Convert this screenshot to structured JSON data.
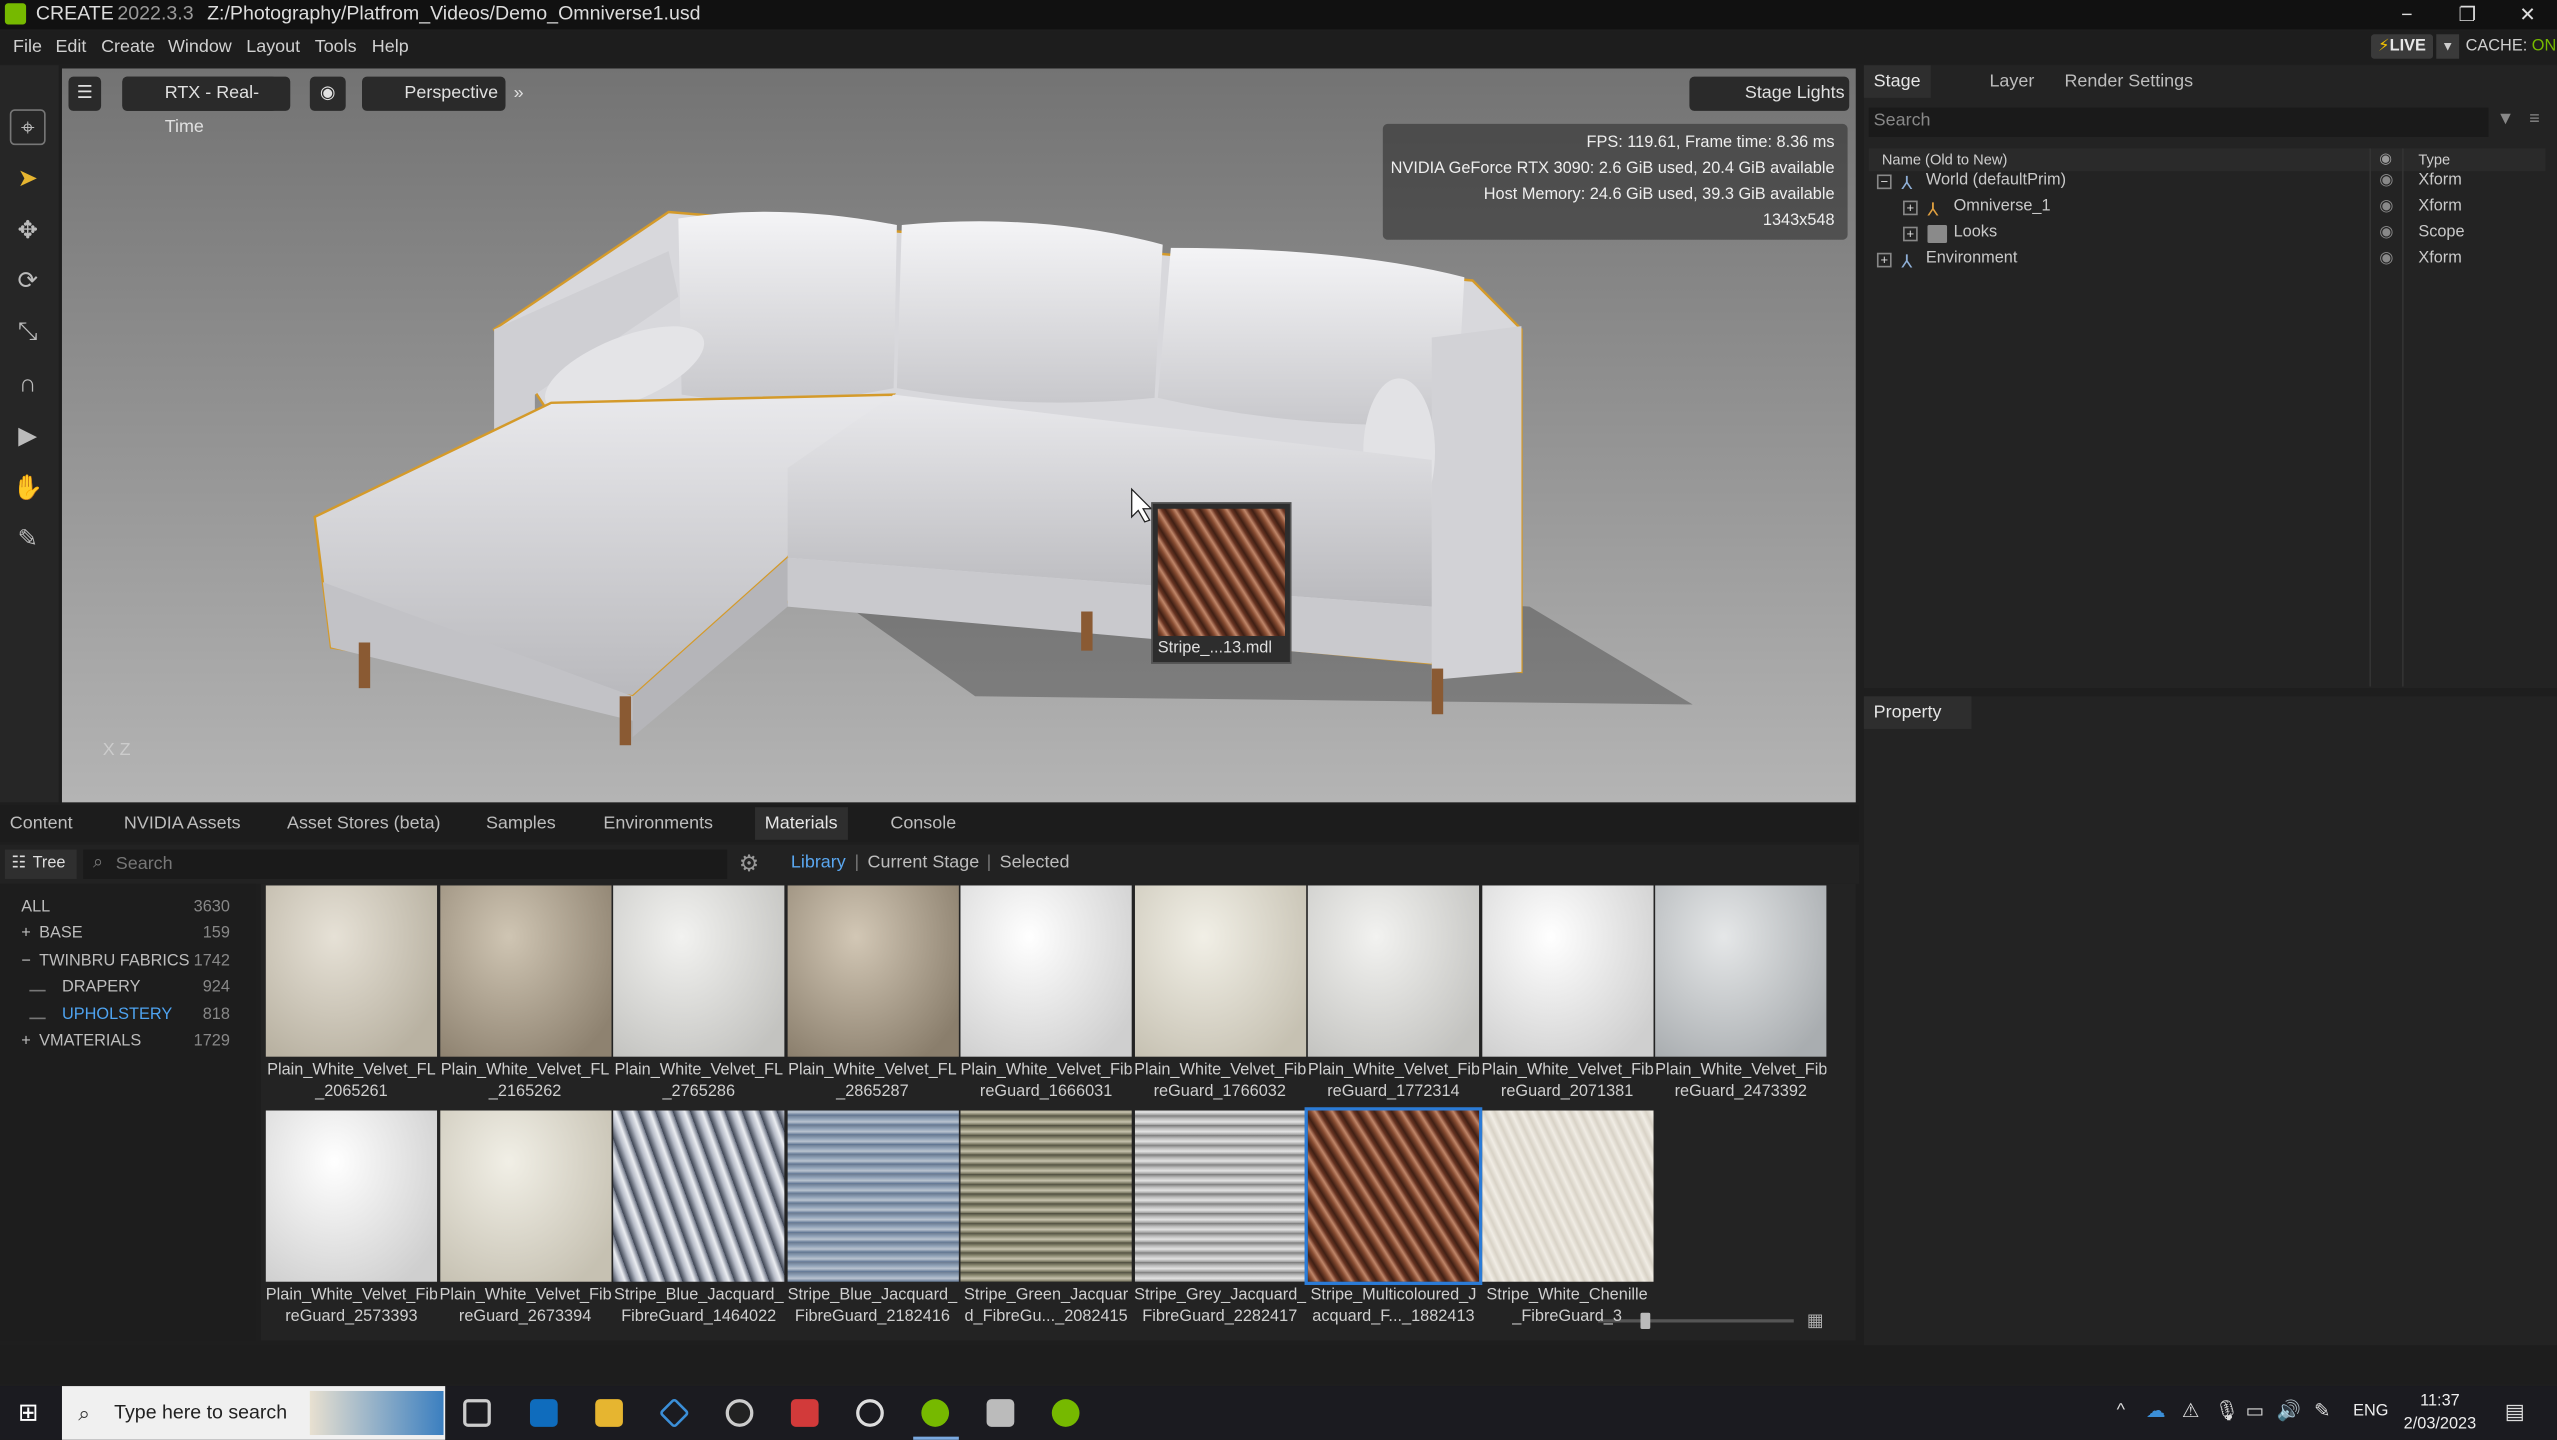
{
  "titlebar": {
    "app": "CREATE",
    "version": "2022.3.3",
    "path": "Z:/Photography/Platfrom_Videos/Demo_Omniverse1.usd",
    "minimize": "−",
    "restore": "❐",
    "close": "✕"
  },
  "menu": [
    "File",
    "Edit",
    "Create",
    "Window",
    "Layout",
    "Tools",
    "Help"
  ],
  "live": {
    "label": "LIVE",
    "cache_label": "CACHE:",
    "cache_value": "ON"
  },
  "viewport": {
    "render_mode": "RTX - Real-Time",
    "camera": "Perspective",
    "stage_lights": "Stage Lights",
    "stats": [
      "FPS: 119.61, Frame time: 8.36 ms",
      "NVIDIA GeForce RTX 3090: 2.6 GiB used, 20.4 GiB available",
      "Host Memory: 24.6 GiB used, 39.3 GiB available",
      "1343x548"
    ],
    "tooltip_label": "Stripe_...13.mdl",
    "axes": "X Z"
  },
  "stage": {
    "tabs": [
      "Stage",
      "Layer",
      "Render Settings"
    ],
    "search_placeholder": "Search",
    "col_name": "Name (Old to New)",
    "col_type": "Type",
    "rows": [
      {
        "name": "World (defaultPrim)",
        "type": "Xform",
        "indent": 0,
        "exp": "−"
      },
      {
        "name": "Omniverse_1",
        "type": "Xform",
        "indent": 1,
        "exp": "+"
      },
      {
        "name": "Looks",
        "type": "Scope",
        "indent": 1,
        "exp": "+"
      },
      {
        "name": "Environment",
        "type": "Xform",
        "indent": 0,
        "exp": "+"
      }
    ]
  },
  "property": {
    "tab": "Property"
  },
  "bottom_tabs": [
    "Content",
    "NVIDIA Assets",
    "Asset Stores (beta)",
    "Samples",
    "Environments",
    "Materials",
    "Console"
  ],
  "materials": {
    "tree_label": "Tree",
    "search_placeholder": "Search",
    "filters": [
      "Library",
      "Current Stage",
      "Selected"
    ],
    "categories": [
      {
        "label": "ALL",
        "count": "3630",
        "prefix": "",
        "level": 0
      },
      {
        "label": "BASE",
        "count": "159",
        "prefix": "+",
        "level": 0
      },
      {
        "label": "TWINBRU FABRICS",
        "count": "1742",
        "prefix": "−",
        "level": 0
      },
      {
        "label": "DRAPERY",
        "count": "924",
        "prefix": "",
        "level": 1
      },
      {
        "label": "UPHOLSTERY",
        "count": "818",
        "prefix": "",
        "level": 1
      },
      {
        "label": "VMATERIALS",
        "count": "1729",
        "prefix": "+",
        "level": 0
      }
    ],
    "tiles": [
      {
        "l1": "Plain_White_Velvet_FL",
        "l2": "_2065261",
        "swatch": "velvet-beige"
      },
      {
        "l1": "Plain_White_Velvet_FL",
        "l2": "_2165262",
        "swatch": "velvet-tan"
      },
      {
        "l1": "Plain_White_Velvet_FL",
        "l2": "_2765286",
        "swatch": "velvet-white"
      },
      {
        "l1": "Plain_White_Velvet_FL",
        "l2": "_2865287",
        "swatch": "velvet-taupe"
      },
      {
        "l1": "Plain_White_Velvet_Fib",
        "l2": "reGuard_1666031",
        "swatch": "velvet-bright"
      },
      {
        "l1": "Plain_White_Velvet_Fib",
        "l2": "reGuard_1766032",
        "swatch": "velvet-cream"
      },
      {
        "l1": "Plain_White_Velvet_Fib",
        "l2": "reGuard_1772314",
        "swatch": "velvet-white"
      },
      {
        "l1": "Plain_White_Velvet_Fib",
        "l2": "reGuard_2071381",
        "swatch": "velvet-bright"
      },
      {
        "l1": "Plain_White_Velvet_Fib",
        "l2": "reGuard_2473392",
        "swatch": "velvet-grey"
      },
      {
        "l1": "Plain_White_Velvet_Fib",
        "l2": "reGuard_2573393",
        "swatch": "velvet-bright"
      },
      {
        "l1": "Plain_White_Velvet_Fib",
        "l2": "reGuard_2673394",
        "swatch": "velvet-cream"
      },
      {
        "l1": "Stripe_Blue_Jacquard_",
        "l2": "FibreGuard_1464022",
        "swatch": "stripe-blue"
      },
      {
        "l1": "Stripe_Blue_Jacquard_",
        "l2": "FibreGuard_2182416",
        "swatch": "stripe-blue-knit"
      },
      {
        "l1": "Stripe_Green_Jacquar",
        "l2": "d_FibreGu..._2082415",
        "swatch": "stripe-green"
      },
      {
        "l1": "Stripe_Grey_Jacquard_",
        "l2": "FibreGuard_2282417",
        "swatch": "stripe-grey"
      },
      {
        "l1": "Stripe_Multicoloured_J",
        "l2": "acquard_F..._1882413",
        "swatch": "stripe-brown",
        "selected": true
      },
      {
        "l1": "Stripe_White_Chenille",
        "l2": "_FibreGuard_3",
        "swatch": "chenille-white"
      }
    ]
  },
  "taskbar": {
    "search_placeholder": "Type here to search",
    "lang": "ENG",
    "time": "11:37",
    "date": "2/03/2023"
  },
  "colors": {
    "accent": "#76b900",
    "selection": "#2b7bd6",
    "highlight": "#d49a2a"
  }
}
